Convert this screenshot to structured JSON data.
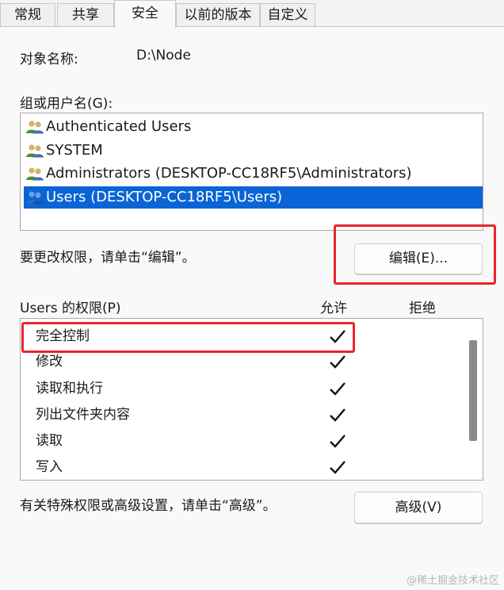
{
  "tabs": [
    {
      "label": "常规",
      "active": false
    },
    {
      "label": "共享",
      "active": false
    },
    {
      "label": "安全",
      "active": true
    },
    {
      "label": "以前的版本",
      "active": false
    },
    {
      "label": "自定义",
      "active": false
    }
  ],
  "object": {
    "label": "对象名称:",
    "value": "D:\\Node"
  },
  "groups": {
    "label": "组或用户名(G):",
    "items": [
      {
        "name": "Authenticated Users",
        "selected": false
      },
      {
        "name": "SYSTEM",
        "selected": false
      },
      {
        "name": "Administrators (DESKTOP-CC18RF5\\Administrators)",
        "selected": false
      },
      {
        "name": "Users (DESKTOP-CC18RF5\\Users)",
        "selected": true
      }
    ]
  },
  "edit_section": {
    "hint": "要更改权限，请单击“编辑”。",
    "button_label": "编辑(E)..."
  },
  "permissions": {
    "title": "Users 的权限(P)",
    "allow_header": "允许",
    "deny_header": "拒绝",
    "rows": [
      {
        "name": "完全控制",
        "allow": true,
        "deny": false
      },
      {
        "name": "修改",
        "allow": true,
        "deny": false
      },
      {
        "name": "读取和执行",
        "allow": true,
        "deny": false
      },
      {
        "name": "列出文件夹内容",
        "allow": true,
        "deny": false
      },
      {
        "name": "读取",
        "allow": true,
        "deny": false
      },
      {
        "name": "写入",
        "allow": true,
        "deny": false
      }
    ]
  },
  "advanced": {
    "hint": "有关特殊权限或高级设置，请单击“高级”。",
    "button_label": "高级(V)"
  },
  "watermark": "@稀土掘金技术社区",
  "colors": {
    "selection": "#0a64d6",
    "highlight_red": "#e8262b"
  }
}
